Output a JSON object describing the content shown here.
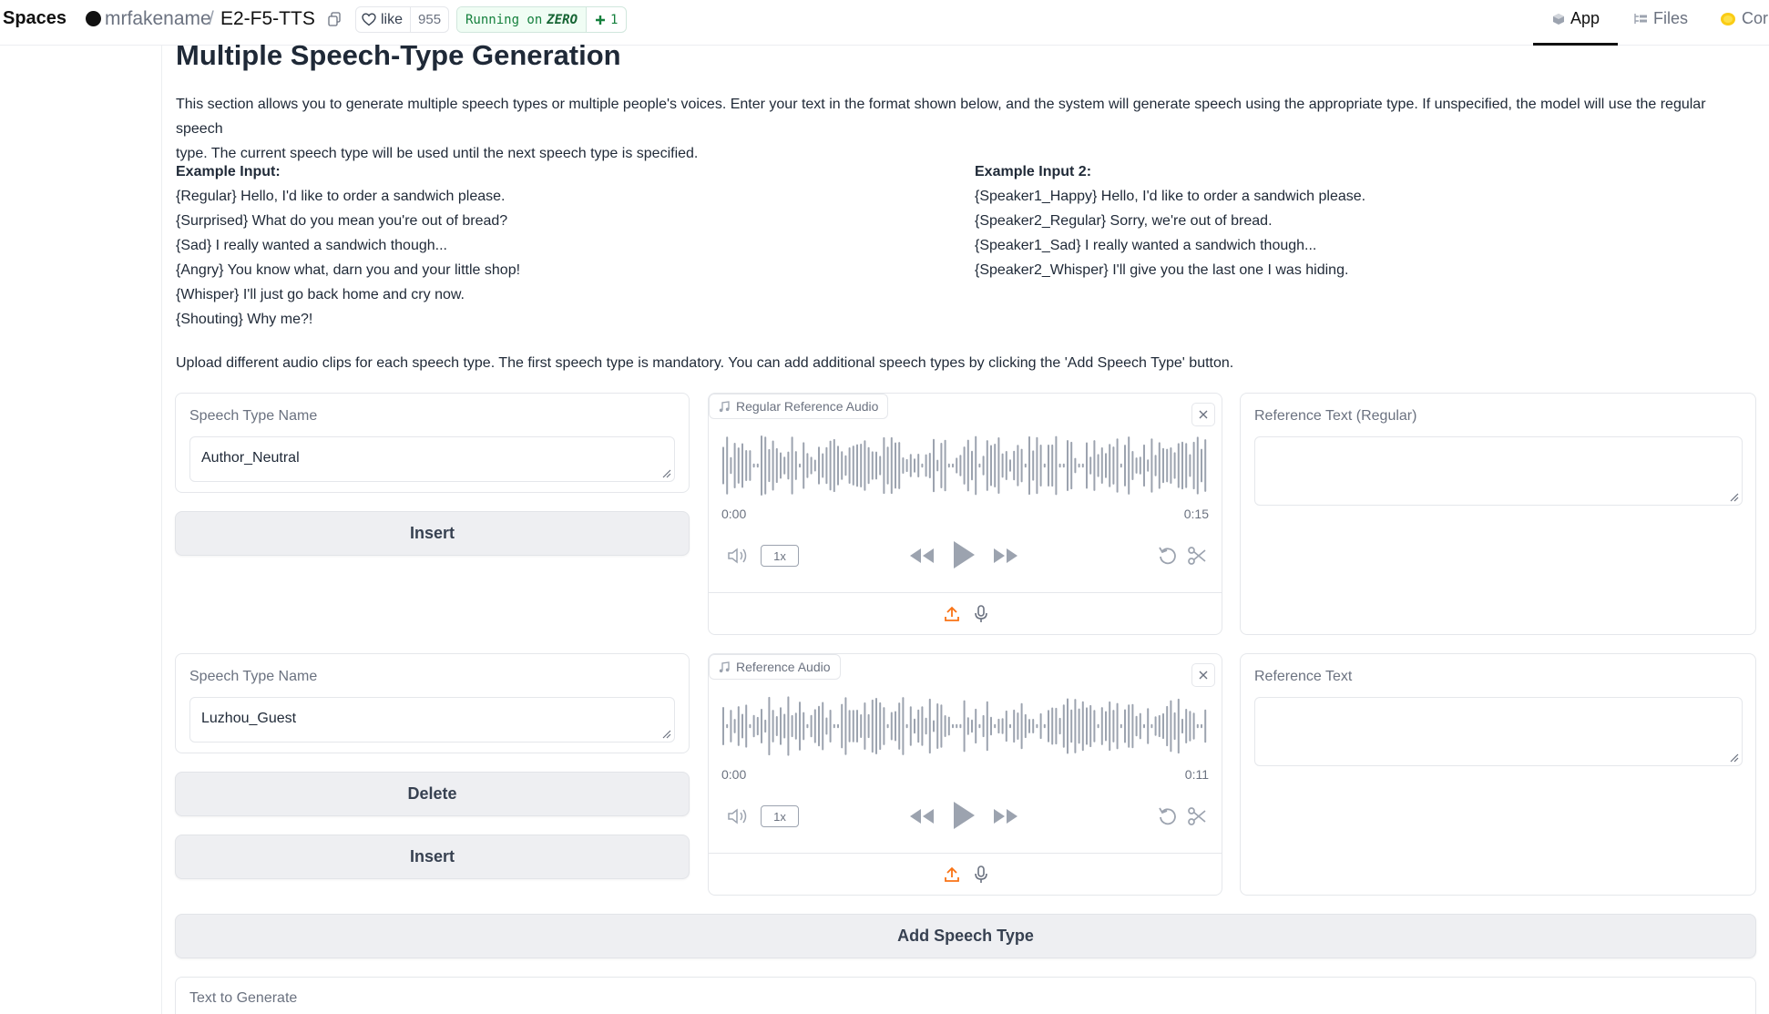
{
  "header": {
    "brand": "Spaces",
    "owner": "mrfakename",
    "slash": "/",
    "repo": "E2-F5-TTS",
    "like_label": "like",
    "like_count": "955",
    "running_prefix": "Running on",
    "running_hw": "ZERO",
    "replicas": "1",
    "tabs": [
      {
        "label": "App",
        "icon": "app-cube-icon"
      },
      {
        "label": "Files",
        "icon": "files-tree-icon"
      },
      {
        "label": "Cor",
        "icon": "community-coin-icon"
      }
    ]
  },
  "main": {
    "title": "Multiple Speech-Type Generation",
    "intro_line1": "This section allows you to generate multiple speech types or multiple people's voices. Enter your text in the format shown below, and the system will generate speech using the appropriate type. If unspecified, the model will use the regular speech",
    "intro_line2": "type. The current speech type will be used until the next speech type is specified.",
    "example1": {
      "heading": "Example Input:",
      "lines": [
        "{Regular} Hello, I'd like to order a sandwich please.",
        "{Surprised} What do you mean you're out of bread?",
        "{Sad} I really wanted a sandwich though...",
        "{Angry} You know what, darn you and your little shop!",
        "{Whisper} I'll just go back home and cry now.",
        "{Shouting} Why me?!"
      ]
    },
    "example2": {
      "heading": "Example Input 2:",
      "lines": [
        "{Speaker1_Happy} Hello, I'd like to order a sandwich please.",
        "{Speaker2_Regular} Sorry, we're out of bread.",
        "{Speaker1_Sad} I really wanted a sandwich though...",
        "{Speaker2_Whisper} I'll give you the last one I was hiding."
      ]
    },
    "upload_note": "Upload different audio clips for each speech type. The first speech type is mandatory. You can add additional speech types by clicking the 'Add Speech Type' button.",
    "rows": [
      {
        "name_label": "Speech Type Name",
        "name_value": "Author_Neutral",
        "insert_label": "Insert",
        "audio_label": "Regular Reference Audio",
        "time_start": "0:00",
        "time_end": "0:15",
        "speed": "1x",
        "ref_text_label": "Reference Text (Regular)",
        "ref_text_value": ""
      },
      {
        "name_label": "Speech Type Name",
        "name_value": "Luzhou_Guest",
        "delete_label": "Delete",
        "insert_label": "Insert",
        "audio_label": "Reference Audio",
        "time_start": "0:00",
        "time_end": "0:11",
        "speed": "1x",
        "ref_text_label": "Reference Text",
        "ref_text_value": ""
      }
    ],
    "add_speech_type_label": "Add Speech Type",
    "text_to_generate_label": "Text to Generate"
  },
  "colors": {
    "accent_orange": "#f97316",
    "running_green": "#15803d",
    "waveform_gray": "#9ca3af"
  }
}
